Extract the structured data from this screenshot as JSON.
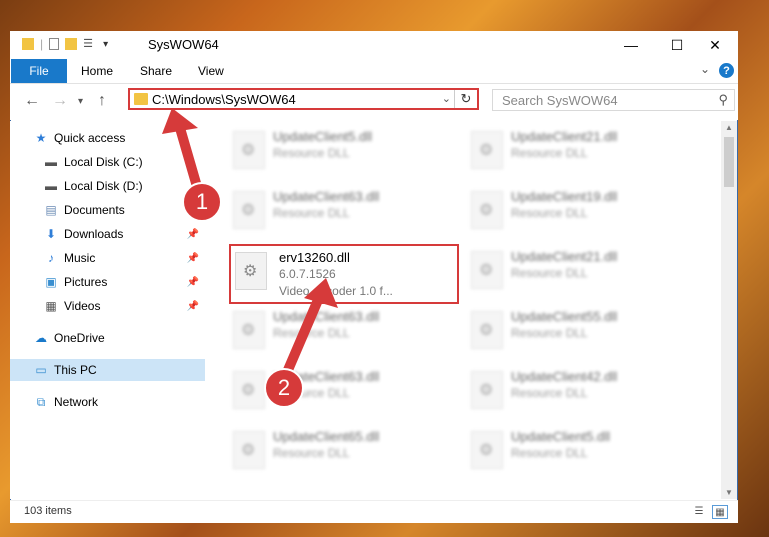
{
  "window": {
    "title": "SysWOW64",
    "controls": {
      "minimize": "—",
      "maximize": "☐",
      "close": "✕"
    }
  },
  "ribbon": {
    "file": "File",
    "tabs": [
      "Home",
      "Share",
      "View"
    ],
    "help": "?"
  },
  "address": {
    "path": "C:\\Windows\\SysWOW64",
    "search_placeholder": "Search SysWOW64"
  },
  "sidebar": {
    "items": [
      {
        "label": "Quick access",
        "icon": "star-icon"
      },
      {
        "label": "Local Disk (C:)",
        "icon": "drive-icon"
      },
      {
        "label": "Local Disk (D:)",
        "icon": "drive-icon"
      },
      {
        "label": "Documents",
        "icon": "documents-icon"
      },
      {
        "label": "Downloads",
        "icon": "downloads-icon"
      },
      {
        "label": "Music",
        "icon": "music-icon"
      },
      {
        "label": "Pictures",
        "icon": "pictures-icon"
      },
      {
        "label": "Videos",
        "icon": "videos-icon"
      },
      {
        "label": "OneDrive",
        "icon": "cloud-icon"
      },
      {
        "label": "This PC",
        "icon": "computer-icon"
      },
      {
        "label": "Network",
        "icon": "network-icon"
      }
    ]
  },
  "files": [
    {
      "name": "UpdateClient5.dll",
      "desc": "Resource DLL"
    },
    {
      "name": "UpdateClient21.dll",
      "desc": "Resource DLL"
    },
    {
      "name": "UpdateClient63.dll",
      "desc": "Resource DLL"
    },
    {
      "name": "UpdateClient19.dll",
      "desc": "Resource DLL"
    },
    {
      "name": "erv13260.dll",
      "desc": "6.0.7.1526",
      "desc2": "Video decoder 1.0 f..."
    },
    {
      "name": "UpdateClient21.dll",
      "desc": "Resource DLL"
    },
    {
      "name": "UpdateClient63.dll",
      "desc": "Resource DLL"
    },
    {
      "name": "UpdateClient55.dll",
      "desc": "Resource DLL"
    },
    {
      "name": "UpdateClient63.dll",
      "desc": "Resource DLL"
    },
    {
      "name": "UpdateClient42.dll",
      "desc": "Resource DLL"
    },
    {
      "name": "UpdateClient65.dll",
      "desc": "Resource DLL"
    },
    {
      "name": "UpdateClient5.dll",
      "desc": "Resource DLL"
    }
  ],
  "status": {
    "item_count": "103 items"
  },
  "annotations": {
    "step1": "1",
    "step2": "2"
  },
  "colors": {
    "accent": "#1979ca",
    "highlight": "#d63a3a",
    "selection": "#cce4f7"
  }
}
